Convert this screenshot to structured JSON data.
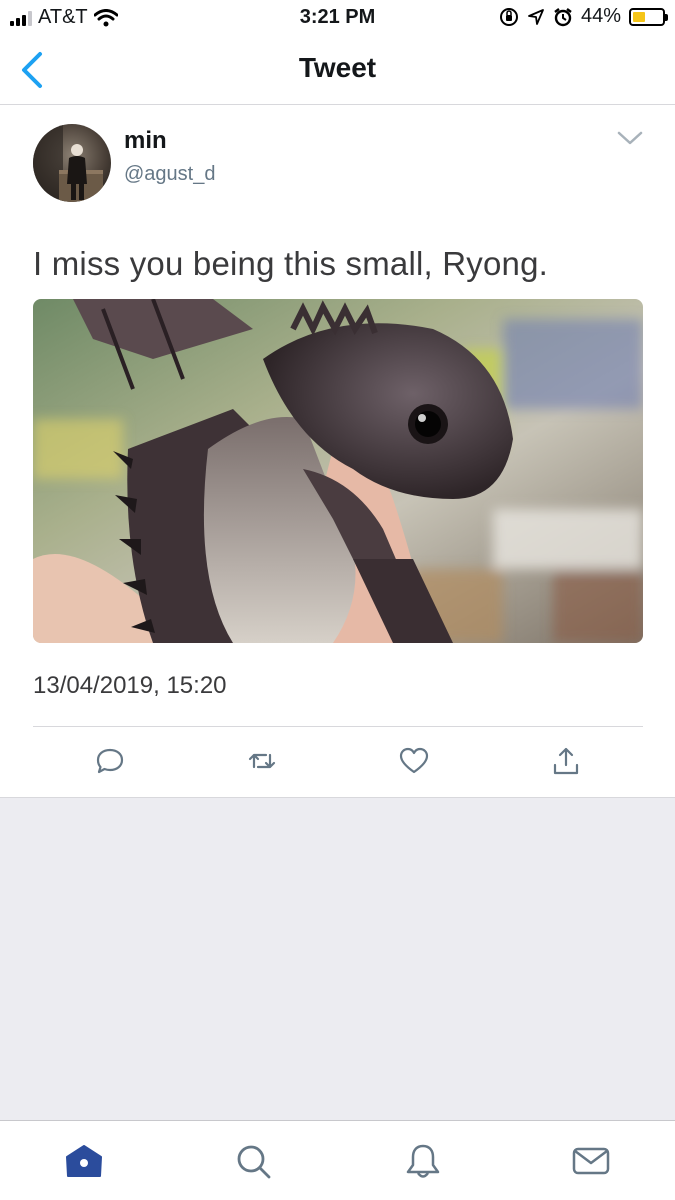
{
  "status_bar": {
    "carrier": "AT&T",
    "time": "3:21 PM",
    "battery_percent": "44%",
    "battery_level": 0.44,
    "icons": [
      "cellular-signal-icon",
      "wifi-icon",
      "orientation-lock-icon",
      "location-icon",
      "alarm-icon",
      "battery-icon"
    ]
  },
  "nav": {
    "title": "Tweet",
    "back_icon": "chevron-left-icon"
  },
  "tweet": {
    "display_name": "min",
    "handle": "@agust_d",
    "text": "I miss you being this small, Ryong.",
    "timestamp": "13/04/2019, 15:20",
    "actions": [
      "reply-icon",
      "retweet-icon",
      "like-icon",
      "share-icon"
    ]
  },
  "tab_bar": {
    "tabs": [
      "home-icon",
      "search-icon",
      "notifications-icon",
      "messages-icon"
    ],
    "active": "home-icon"
  },
  "colors": {
    "accent": "#1da1f2",
    "active_tab": "#2b4c9c",
    "secondary_text": "#657786",
    "battery": "#f5c518",
    "background": "#ececf1"
  }
}
